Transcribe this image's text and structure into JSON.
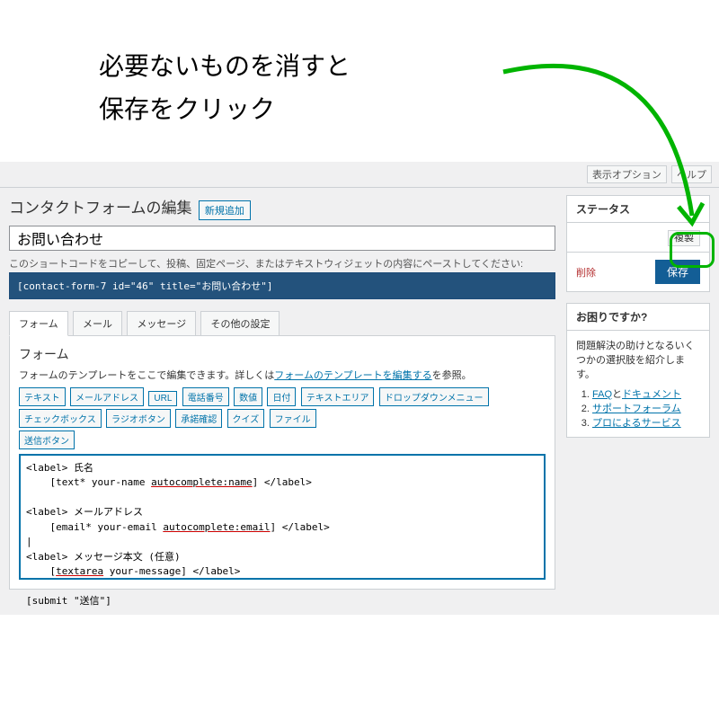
{
  "annotation": {
    "line1": "必要ないものを消すと",
    "line2": "保存をクリック"
  },
  "topControls": {
    "a": "表示オプション",
    "b": "ヘルプ"
  },
  "header": {
    "title": "コンタクトフォームの編集",
    "addNew": "新規追加"
  },
  "formTitle": "お問い合わせ",
  "shortcodeHint": "このショートコードをコピーして、投稿、固定ページ、またはテキストウィジェットの内容にペーストしてください:",
  "shortcode": "[contact-form-7 id=\"46\" title=\"お問い合わせ\"]",
  "tabs": {
    "form": "フォーム",
    "mail": "メール",
    "messages": "メッセージ",
    "settings": "その他の設定"
  },
  "form": {
    "heading": "フォーム",
    "desc1": "フォームのテンプレートをここで編集できます。詳しくは",
    "descLink": "フォームのテンプレートを編集する",
    "desc2": "を参照。",
    "tagButtons": [
      "テキスト",
      "メールアドレス",
      "URL",
      "電話番号",
      "数値",
      "日付",
      "テキストエリア",
      "ドロップダウンメニュー",
      "チェックボックス",
      "ラジオボタン",
      "承諾確認",
      "クイズ",
      "ファイル",
      "送信ボタン"
    ]
  },
  "status": {
    "title": "ステータス",
    "copy": "複製",
    "delete": "削除",
    "save": "保存"
  },
  "help": {
    "title": "お困りですか?",
    "desc": "問題解決の助けとなるいくつかの選択肢を紹介します。",
    "items": [
      {
        "a": "FAQ",
        "mid": "と",
        "b": "ドキュメント"
      },
      {
        "a": "サポートフォーラム",
        "mid": "",
        "b": ""
      },
      {
        "a": "プロによるサービス",
        "mid": "",
        "b": ""
      }
    ]
  }
}
